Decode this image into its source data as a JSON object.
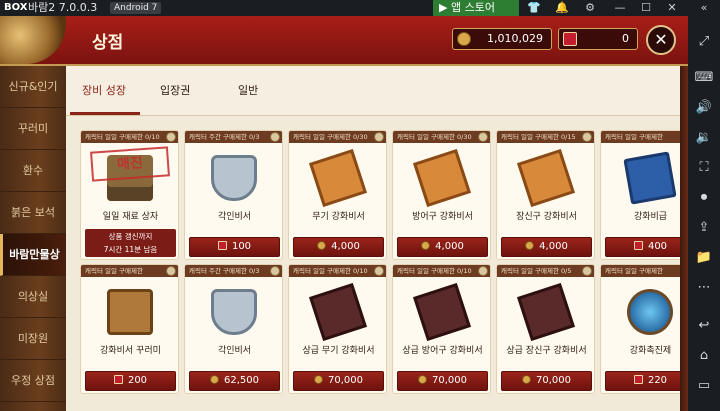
{
  "emulator": {
    "logo": "BOX",
    "app_name": "바람2 7.0.0.3",
    "android_badge": "Android 7",
    "app_store_label": "앱 스토어"
  },
  "header": {
    "title": "상점",
    "gold": "1,010,029",
    "rubies": "0"
  },
  "nav": {
    "items": [
      "신규&인기",
      "꾸러미",
      "환수",
      "붉은 보석",
      "바람만물상",
      "의상실",
      "미장원",
      "우정 상점"
    ],
    "active_index": 4
  },
  "tabs": [
    "장비 성장",
    "입장권",
    "일반"
  ],
  "cards": [
    {
      "banner": "캐릭터 일일 구매제한 0/10",
      "name": "일일 재료 상자",
      "sold_out": "매진",
      "timer_line1": "상품 갱신까지",
      "timer_line2": "7시간 11분 남음",
      "icon": "box-icon"
    },
    {
      "banner": "캐릭터 주간 구매제한 0/3",
      "name": "각인비서",
      "price": "100",
      "currency": "ruby",
      "icon": "shield-scroll-icon"
    },
    {
      "banner": "캐릭터 일일 구매제한 0/30",
      "name": "무기 강화비서",
      "price": "4,000",
      "currency": "gold",
      "icon": "scroll-icon"
    },
    {
      "banner": "캐릭터 일일 구매제한 0/30",
      "name": "방어구 강화비서",
      "price": "4,000",
      "currency": "gold",
      "icon": "scroll-icon"
    },
    {
      "banner": "캐릭터 일일 구매제한 0/15",
      "name": "장신구 강화비서",
      "price": "4,000",
      "currency": "gold",
      "icon": "scroll-icon"
    },
    {
      "banner": "캐릭터 일일 구매제한",
      "name": "강화비급",
      "price": "400",
      "currency": "ruby",
      "icon": "book-icon"
    },
    {
      "banner": "캐릭터 일일 구매제한",
      "name": "강화비서 꾸러미",
      "price": "200",
      "currency": "ruby",
      "icon": "bundle-icon"
    },
    {
      "banner": "캐릭터 주간 구매제한 0/3",
      "name": "각인비서",
      "price": "62,500",
      "currency": "gold",
      "icon": "shield-scroll-icon"
    },
    {
      "banner": "캐릭터 일일 구매제한 0/10",
      "name": "상급 무기 강화비서",
      "price": "70,000",
      "currency": "gold",
      "icon": "dark-scroll-icon"
    },
    {
      "banner": "캐릭터 일일 구매제한 0/10",
      "name": "상급 방어구 강화비서",
      "price": "70,000",
      "currency": "gold",
      "icon": "dark-scroll-icon"
    },
    {
      "banner": "캐릭터 일일 구매제한 0/5",
      "name": "상급 장신구 강화비서",
      "price": "70,000",
      "currency": "gold",
      "icon": "dark-scroll-icon"
    },
    {
      "banner": "캐릭터 일일 구매제한",
      "name": "강화촉진제",
      "price": "220",
      "currency": "ruby",
      "icon": "potion-icon"
    }
  ],
  "colors": {
    "accent": "#8a2318",
    "header": "#a81e17",
    "gold": "#d8a84a",
    "ruby": "#c21e2d"
  }
}
